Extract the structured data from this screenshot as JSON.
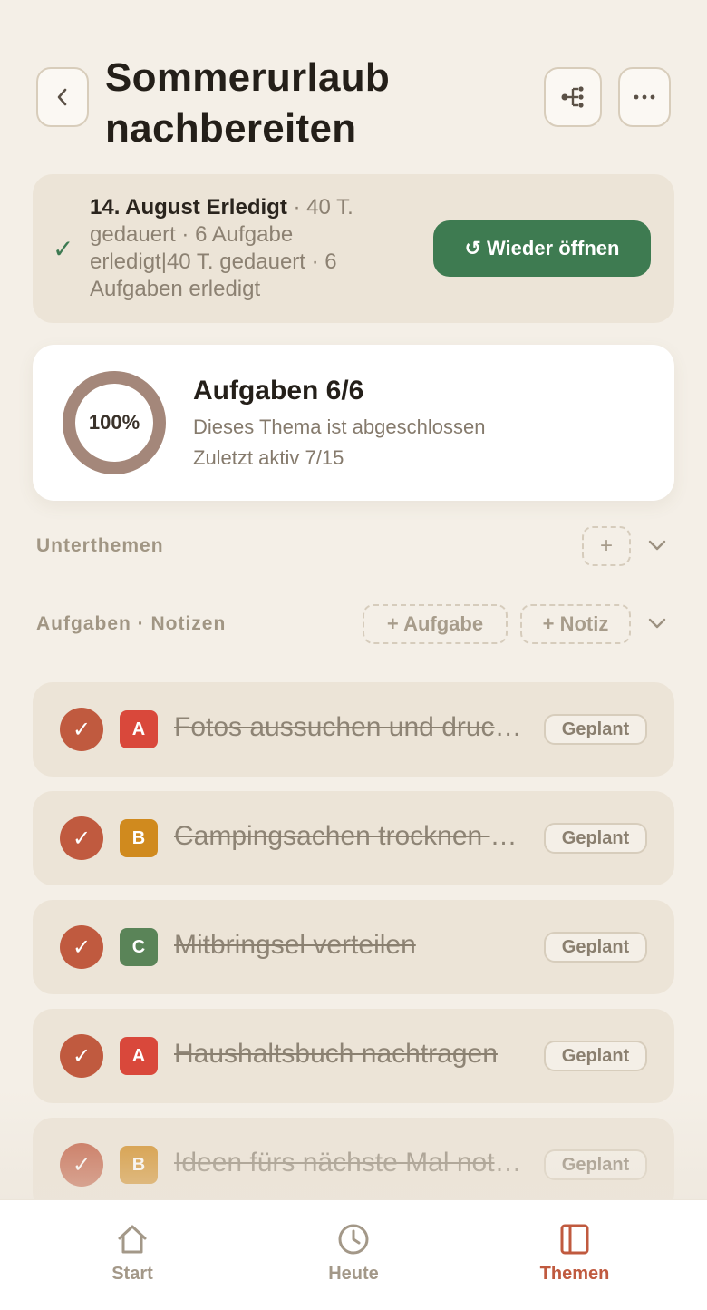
{
  "header": {
    "title": "Sommerurlaub nachbereiten"
  },
  "banner": {
    "date_status": "14. August Erledigt",
    "details": " · 40 T. gedauert · 6 Aufgabe erledigt|40 T. gedauert · 6 Aufgaben erledigt",
    "reopen_label": "Wieder öffnen"
  },
  "progress": {
    "percent": 100,
    "percent_label": "100%",
    "title": "Aufgaben 6/6",
    "subtitle": "Dieses Thema ist abgeschlossen",
    "last_active": "Zuletzt aktiv 7/15"
  },
  "subtopics": {
    "label": "Unterthemen",
    "add_label": "+"
  },
  "tasks_section": {
    "label": "Aufgaben · Notizen",
    "add_task_label": "+ Aufgabe",
    "add_note_label": "+ Notiz"
  },
  "tasks": [
    {
      "priority": "A",
      "text": "Fotos aussuchen und drucken lassen",
      "status": "Geplant"
    },
    {
      "priority": "B",
      "text": "Campingsachen trocknen und verstauen",
      "status": "Geplant"
    },
    {
      "priority": "C",
      "text": "Mitbringsel verteilen",
      "status": "Geplant"
    },
    {
      "priority": "A",
      "text": "Haushaltsbuch nachtragen",
      "status": "Geplant"
    },
    {
      "priority": "B",
      "text": "Ideen fürs nächste Mal notieren",
      "status": "Geplant"
    }
  ],
  "colors": {
    "accent": "#c05a3f",
    "success": "#3e7b51",
    "priority_a": "#d9483b",
    "priority_b": "#d08a1e",
    "priority_c": "#5a8458",
    "ring": "#a4877a"
  },
  "nav": {
    "items": [
      {
        "label": "Start",
        "icon": "home-icon"
      },
      {
        "label": "Heute",
        "icon": "clock-icon"
      },
      {
        "label": "Themen",
        "icon": "book-icon"
      }
    ],
    "active": "Themen"
  }
}
